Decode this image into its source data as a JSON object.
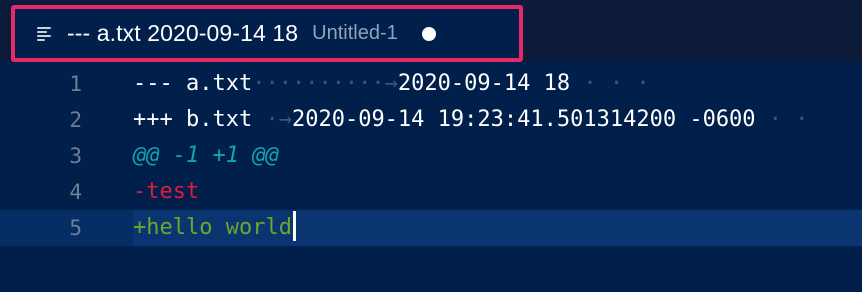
{
  "tab": {
    "icon": "lines-icon",
    "title": "--- a.txt 2020-09-14 18",
    "description": "Untitled-1",
    "dirty": true
  },
  "editor": {
    "lines": [
      {
        "number": "1",
        "text_a": "--- a.txt",
        "whitespace": "··········→",
        "text_b": "2020-09-14 18",
        "trail": " · · ·"
      },
      {
        "number": "2",
        "text_a": "+++ b.txt",
        "whitespace": " ·→",
        "text_b": "2020-09-14 19:23:41.501314200 -0600",
        "trail": " · ·"
      },
      {
        "number": "3",
        "text": "@@ -1 +1 @@"
      },
      {
        "number": "4",
        "text": "-test"
      },
      {
        "number": "5",
        "text": "+hello world"
      }
    ]
  },
  "colors": {
    "accent_border": "#e6296a",
    "background": "#011f4b",
    "deleted": "#e0193d",
    "added": "#6fa52a",
    "hunk": "#0fa3b5"
  }
}
